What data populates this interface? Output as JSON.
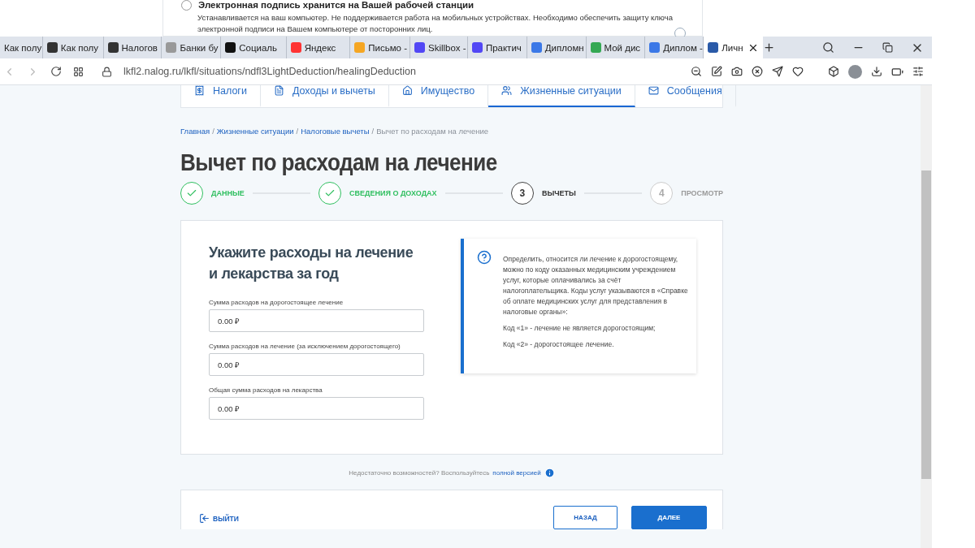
{
  "behind_page": {
    "radio_selected": false,
    "title": "Электронная подпись хранится на Вашей рабочей станции",
    "description": "Устанавливается на ваш компьютер. Не поддерживается работа на мобильных устройствах. Необходимо обеспечить  защиту ключа электронной подписи на Вашем компьютере от посторонних лиц."
  },
  "browser": {
    "tabs": [
      {
        "label": "Как полу",
        "selected": false
      },
      {
        "label": "Как полу",
        "selected": false
      },
      {
        "label": "Налогов",
        "selected": false
      },
      {
        "label": "Банки бу",
        "selected": false
      },
      {
        "label": "Социаль",
        "selected": false
      },
      {
        "label": "Яндекс",
        "selected": false
      },
      {
        "label": "Письмо -",
        "selected": false
      },
      {
        "label": "Skillbox -",
        "selected": false
      },
      {
        "label": "Практич",
        "selected": false
      },
      {
        "label": "Дипломн",
        "selected": false
      },
      {
        "label": "Мой дис",
        "selected": false
      },
      {
        "label": "Диплом -",
        "selected": false
      },
      {
        "label": "Личн",
        "selected": true
      }
    ],
    "url": "lkfl2.nalog.ru/lkfl/situations/ndfl3LightDeduction/healingDeduction"
  },
  "nav": [
    {
      "label": "Налоги",
      "selected": false
    },
    {
      "label": "Доходы и вычеты",
      "selected": false
    },
    {
      "label": "Имущество",
      "selected": false
    },
    {
      "label": "Жизненные ситуации",
      "selected": true
    },
    {
      "label": "Сообщения",
      "selected": false
    }
  ],
  "breadcrumb": [
    {
      "label": "Главная",
      "kind": "link"
    },
    {
      "separator": "/",
      "label": "Жизненные ситуации",
      "kind": "link"
    },
    {
      "separator": "/",
      "label": "Налоговые вычеты",
      "kind": "link"
    },
    {
      "separator": "/",
      "label": "Вычет по расходам на лечение",
      "kind": "current"
    }
  ],
  "title": "Вычет по расходам на лечение",
  "steps": [
    {
      "label": "ДАННЫЕ",
      "done": true,
      "selected": false
    },
    {
      "label": "СВЕДЕНИЯ О ДОХОДАХ",
      "done": true,
      "selected": false
    },
    {
      "number": "3",
      "label": "ВЫЧЕТЫ",
      "done": false,
      "selected": true
    },
    {
      "number": "4",
      "label": "ПРОСМОТР",
      "done": false,
      "selected": false
    }
  ],
  "form": {
    "heading": "Укажите расходы на лечение и лекарства за год",
    "fields": [
      {
        "label": "Сумма расходов на дорогостоящее лечение",
        "value": "0.00 ₽"
      },
      {
        "label": "Сумма расходов на лечение (за исключением дорогостоящего)",
        "value": "0.00 ₽"
      },
      {
        "label": "Общая сумма расходов на лекарства",
        "value": "0.00 ₽"
      }
    ]
  },
  "info": {
    "paragraphs": [
      "Определить, относится ли лечение к дорогостоящему, можно по коду оказанных медицинским учреждением услуг, которые оплачивались за счёт налогоплательщика. Коды услуг указываются в «Справке об оплате медицинских услуг для представления в налоговые органы»:",
      "Код «1» - лечение не является дорогостоящим;",
      "Код «2» - дорогостоящее лечение."
    ]
  },
  "notice": {
    "text": "Недостаточно возможностей? Воспользуйтесь",
    "link": "полной версией"
  },
  "footer": {
    "exit": "ВЫЙТИ",
    "back": "НАЗАД",
    "next": "ДАЛЕЕ"
  }
}
